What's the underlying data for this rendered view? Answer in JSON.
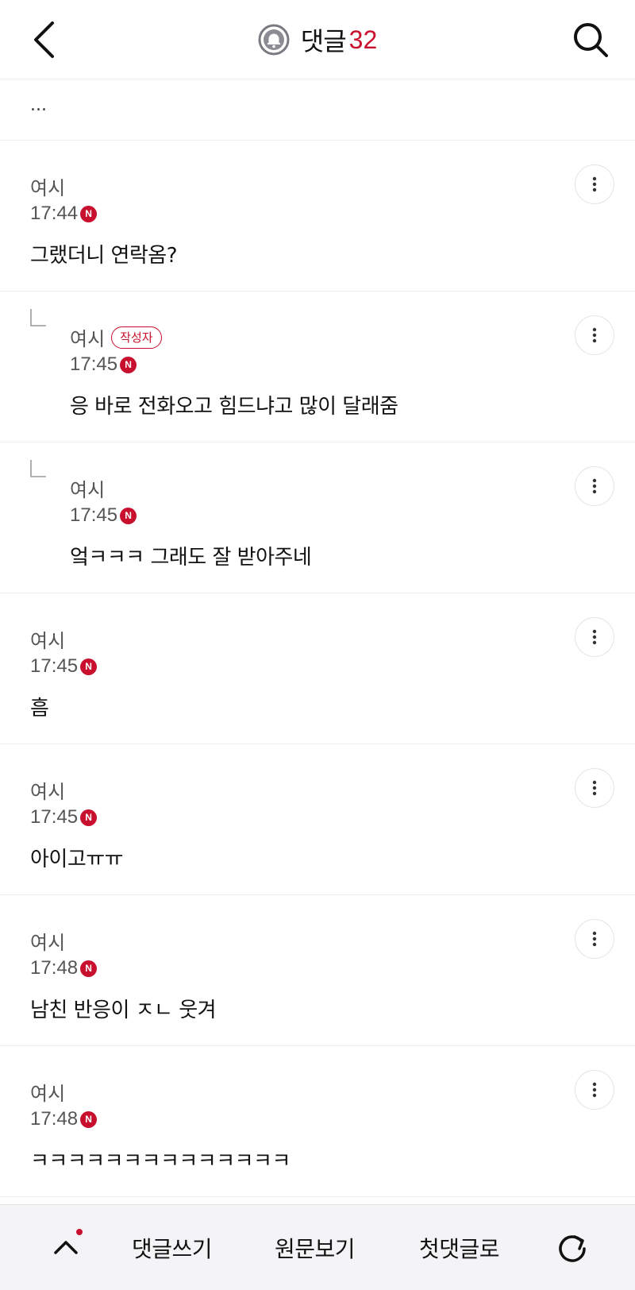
{
  "header": {
    "title": "댓글",
    "count": "32",
    "back_icon": "chevron-left-icon",
    "bell_icon": "bell-icon",
    "search_icon": "search-icon"
  },
  "thread": {
    "ellipsis": "..."
  },
  "comments": [
    {
      "author": "여시",
      "time": "17:44",
      "new": "N",
      "body": "그랬더니 연락옴?",
      "reply": false,
      "op": ""
    },
    {
      "author": "여시",
      "time": "17:45",
      "new": "N",
      "body": "응 바로 전화오고 힘드냐고 많이 달래줌",
      "reply": true,
      "op": "작성자"
    },
    {
      "author": "여시",
      "time": "17:45",
      "new": "N",
      "body": "엌ㅋㅋㅋ 그래도 잘 받아주네",
      "reply": true,
      "op": ""
    },
    {
      "author": "여시",
      "time": "17:45",
      "new": "N",
      "body": "흠",
      "reply": false,
      "op": ""
    },
    {
      "author": "여시",
      "time": "17:45",
      "new": "N",
      "body": "아이고ㅠㅠ",
      "reply": false,
      "op": ""
    },
    {
      "author": "여시",
      "time": "17:48",
      "new": "N",
      "body": "남친 반응이 ㅈㄴ 웃겨",
      "reply": false,
      "op": ""
    },
    {
      "author": "여시",
      "time": "17:48",
      "new": "N",
      "body": "ㅋㅋㅋㅋㅋㅋㅋㅋㅋㅋㅋㅋㅋㅋ",
      "reply": false,
      "op": ""
    }
  ],
  "bottom_bar": {
    "write": "댓글쓰기",
    "original": "원문보기",
    "first": "첫댓글로"
  },
  "colors": {
    "accent": "#c8102e"
  }
}
